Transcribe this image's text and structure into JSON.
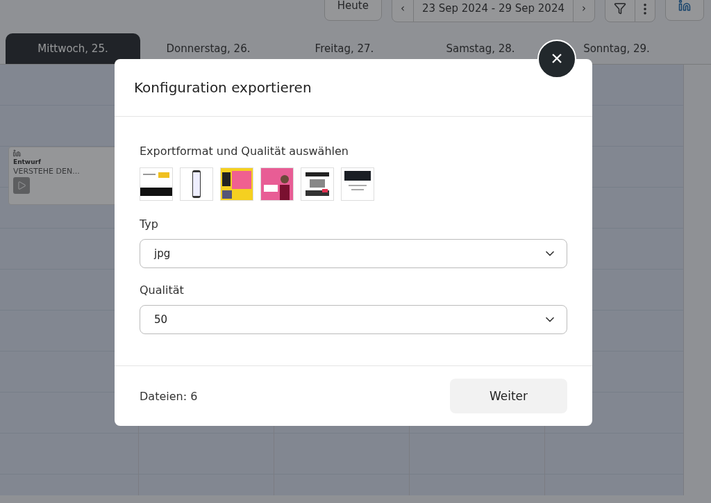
{
  "toolbar": {
    "today_button": "Heute",
    "prev": "‹",
    "date_range": "23 Sep 2024 - 29 Sep 2024",
    "next": "›"
  },
  "day_tabs": [
    {
      "label": "Mittwoch, 25.",
      "selected": true
    },
    {
      "label": "Donnerstag, 26.",
      "selected": false
    },
    {
      "label": "Freitag, 27.",
      "selected": false
    },
    {
      "label": "Samstag, 28.",
      "selected": false
    },
    {
      "label": "Sonntag, 29.",
      "selected": false
    }
  ],
  "post_card": {
    "status": "Entwurf",
    "title": "VERSTEHE DEN..."
  },
  "dialog": {
    "title": "Konfiguration exportieren",
    "close": "×",
    "section_label": "Exportformat und Qualität auswählen",
    "fields": [
      {
        "label": "Typ",
        "value": "jpg"
      },
      {
        "label": "Qualität",
        "value": "50"
      }
    ],
    "file_count": "Dateien: 6",
    "next_button": "Weiter"
  }
}
